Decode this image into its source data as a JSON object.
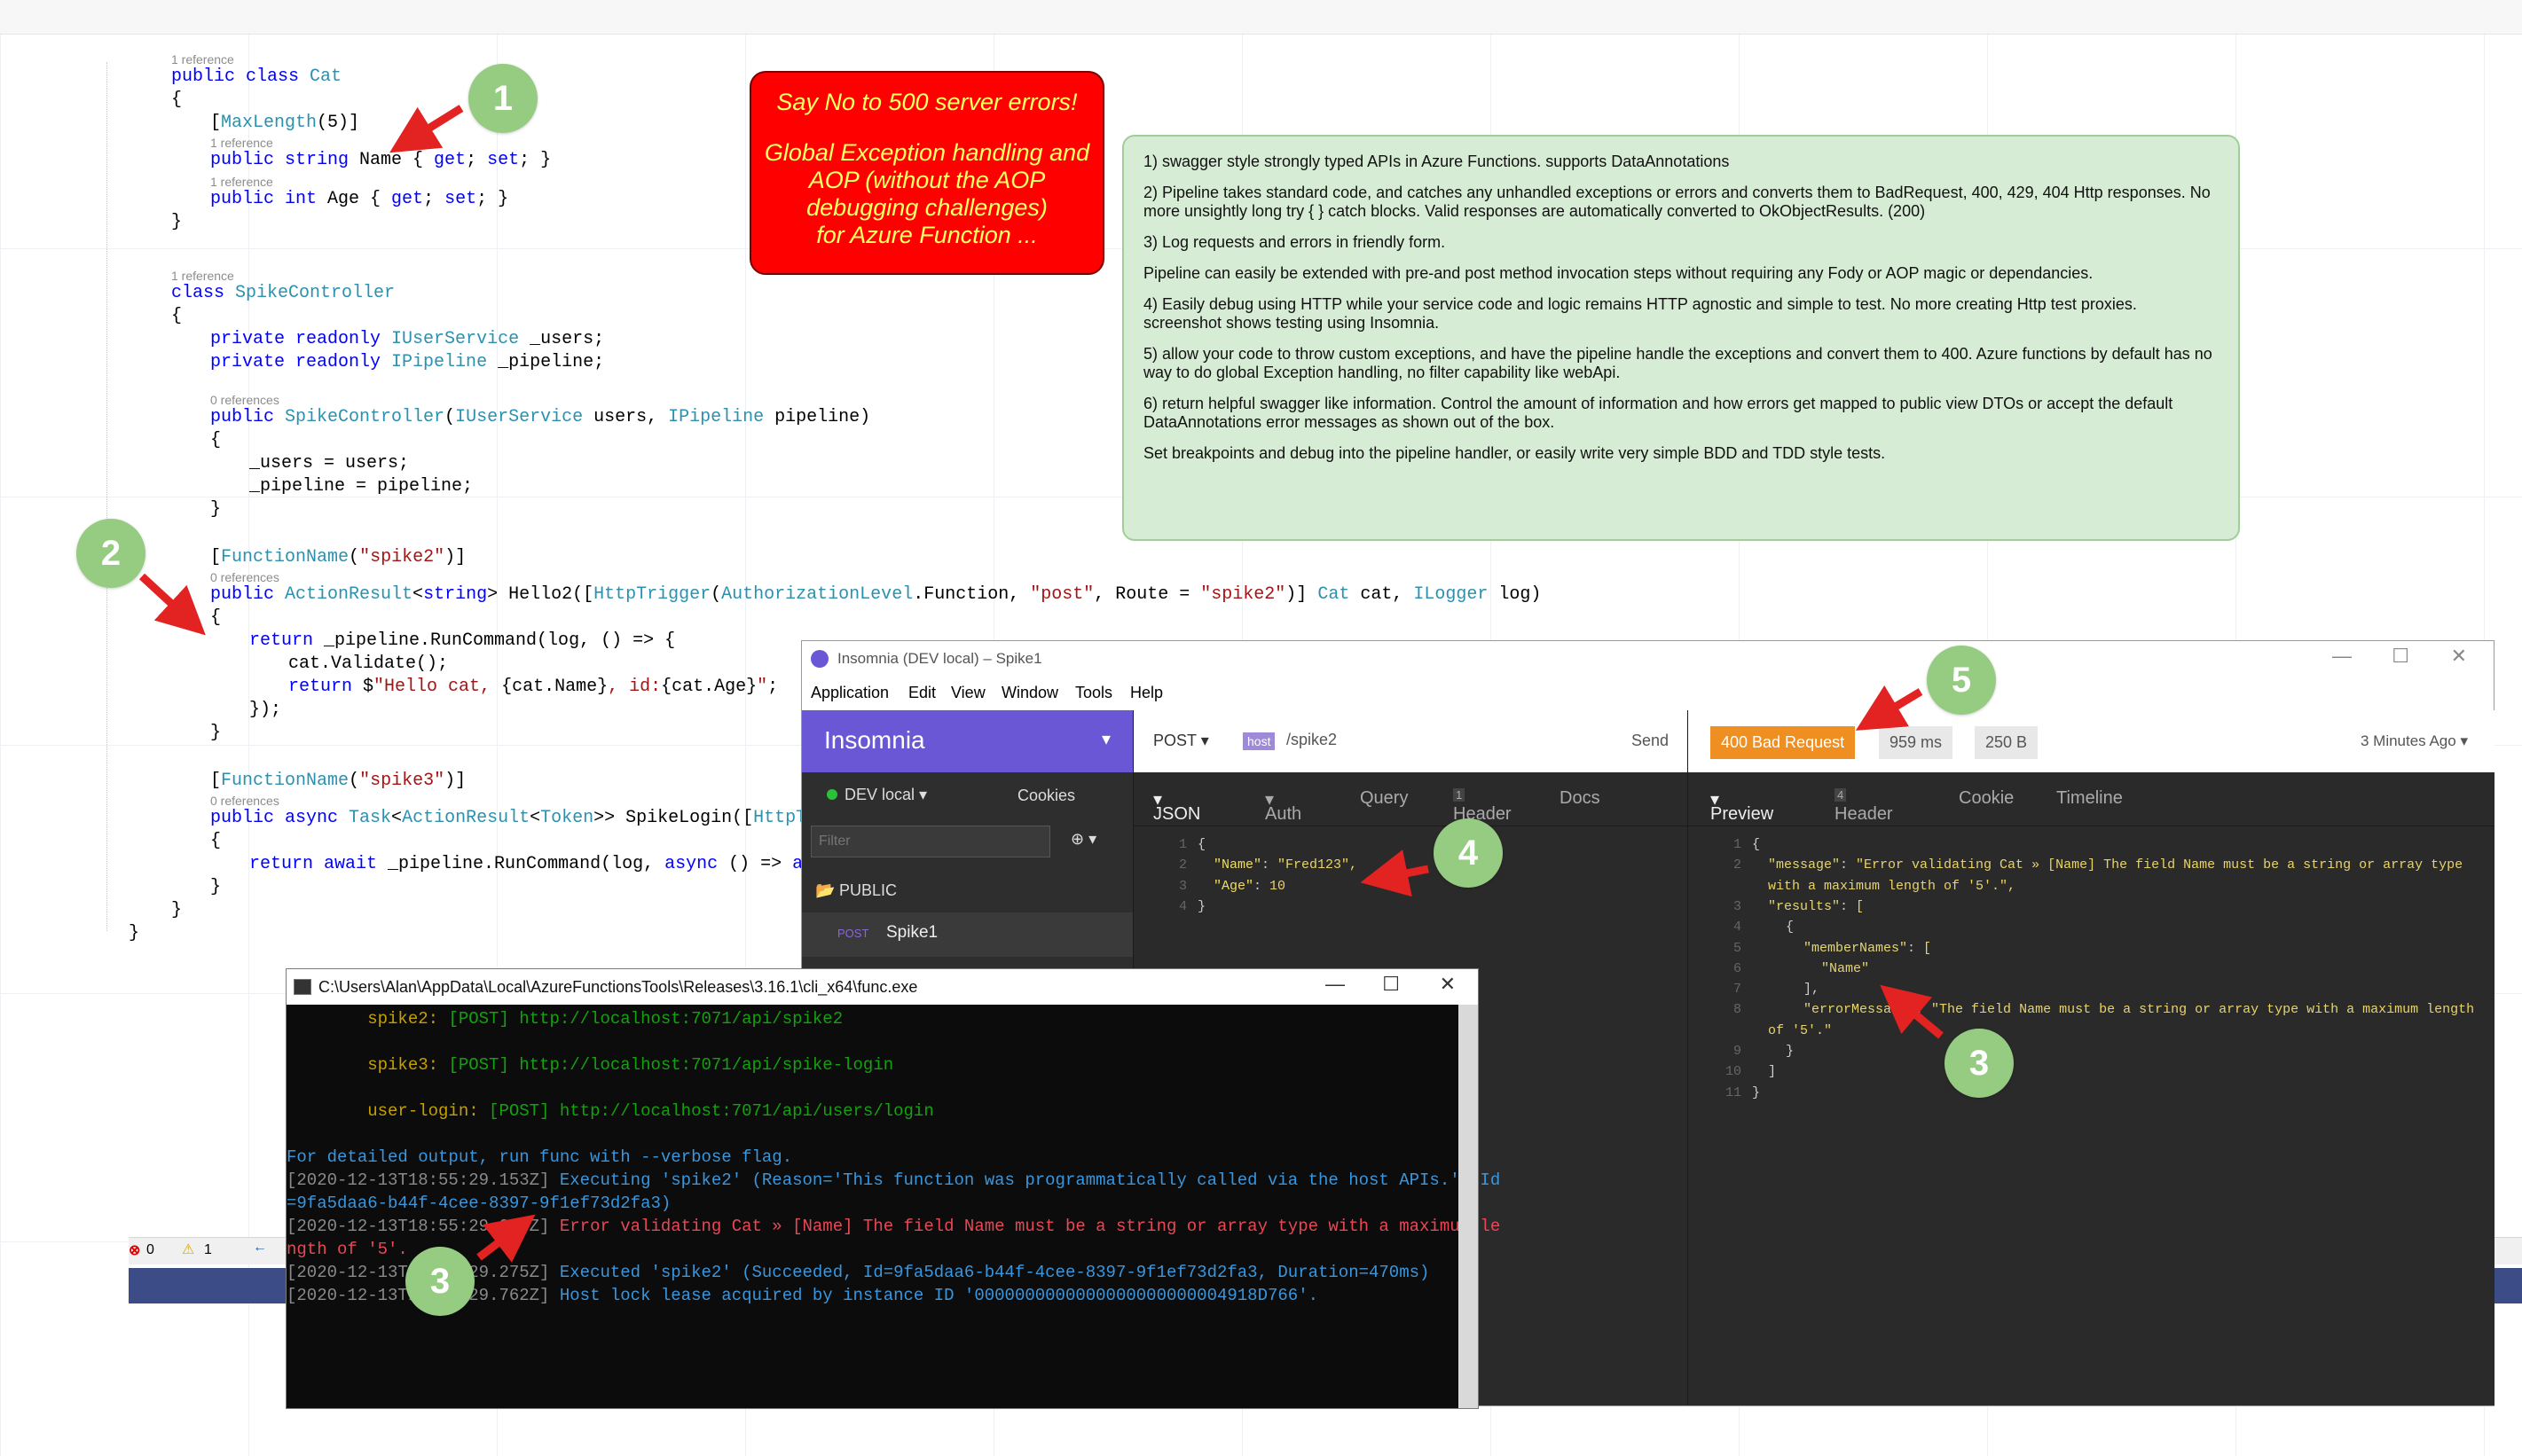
{
  "code": {
    "ref1": "1 reference",
    "ref0": "0 references",
    "l_class_cat": [
      "public class ",
      "Cat"
    ],
    "l_maxlength": [
      "[",
      "MaxLength",
      "(5)]"
    ],
    "l_name": [
      "public string ",
      "Name { ",
      "get",
      "; ",
      "set",
      "; }"
    ],
    "l_age": [
      "public int ",
      "Age { ",
      "get",
      "; ",
      "set",
      "; }"
    ],
    "l_class_spike": [
      "class ",
      "SpikeController"
    ],
    "l_users_field": [
      "private readonly ",
      "IUserService",
      " _users;"
    ],
    "l_pipeline_field": [
      "private readonly ",
      "IPipeline",
      " _pipeline;"
    ],
    "l_ctor": [
      "public ",
      "SpikeController",
      "(",
      "IUserService",
      " users, ",
      "IPipeline",
      " pipeline)"
    ],
    "l_assign_users": "_users = users;",
    "l_assign_pipeline": "_pipeline = pipeline;",
    "l_fn_spike2": [
      "[",
      "FunctionName",
      "(",
      "\"spike2\"",
      ")]"
    ],
    "l_hello2": [
      "public ",
      "ActionResult",
      "<",
      "string",
      "> Hello2([",
      "HttpTrigger",
      "(",
      "AuthorizationLevel",
      ".Function, ",
      "\"post\"",
      ", Route = ",
      "\"spike2\"",
      ")] ",
      "Cat",
      " cat, ",
      "ILogger",
      " log)"
    ],
    "l_return_pipeline": [
      "return",
      " _pipeline.RunCommand(log, () => {"
    ],
    "l_validate": "cat.Validate();",
    "l_return_hello": [
      "return",
      " $",
      "\"Hello cat, ",
      "{cat.Name}",
      ", id:",
      "{cat.Age}",
      "\"",
      ";"
    ],
    "l_close_lambda": "});",
    "l_fn_spike3": [
      "[",
      "FunctionName",
      "(",
      "\"spike3\"",
      ")]"
    ],
    "l_spikelogin": [
      "public async ",
      "Task",
      "<",
      "ActionResult",
      "<",
      "Token",
      ">> SpikeLogin([",
      "HttpTrigge"
    ],
    "l_return_await": [
      "return await",
      " _pipeline.RunCommand(log, ",
      "async",
      " () => ",
      "await"
    ],
    "brace_open": "{",
    "brace_close": "}"
  },
  "callout": {
    "title": "Say No to 500 server errors!",
    "lines": [
      "Global Exception handling and",
      "AOP (without the AOP",
      "debugging challenges)",
      "for Azure Function ..."
    ]
  },
  "notes": [
    "1) swagger style strongly typed APIs in Azure Functions. supports DataAnnotations",
    "2) Pipeline takes standard code, and catches any unhandled exceptions or errors and converts them to BadRequest, 400, 429, 404 Http responses. No more unsightly long try { } catch blocks. Valid responses are automatically converted to OkObjectResults. (200)",
    "3) Log requests and errors in friendly form.",
    "Pipeline can easily be extended with pre-and post method invocation steps without requiring any Fody or AOP magic or dependancies.",
    "4) Easily debug using HTTP while your service code and logic remains HTTP agnostic and simple to test. No more creating Http test proxies. screenshot shows testing using Insomnia.",
    "5) allow your code to throw custom exceptions, and have the pipeline handle the exceptions and convert them to 400. Azure functions by default has no way to do global Exception handling, no filter capability like webApi.",
    "6) return helpful swagger like information. Control the amount of information and how errors get mapped to public view DTOs or accept the default DataAnnotations error messages as shown out of the box.",
    "Set breakpoints and debug into the pipeline handler, or easily write very simple BDD and TDD style tests."
  ],
  "badges": [
    "1",
    "2",
    "3",
    "4",
    "5",
    "3",
    "3"
  ],
  "insomnia": {
    "window_title": "Insomnia (DEV local) – Spike1",
    "menu": [
      "Application",
      "Edit",
      "View",
      "Window",
      "Tools",
      "Help"
    ],
    "brand": "Insomnia",
    "env": "DEV local",
    "cookies": "Cookies",
    "filter_placeholder": "Filter",
    "folder": "PUBLIC",
    "req_method": "POST",
    "req_name": "Spike1",
    "method": "POST",
    "host_tag": "host",
    "url_path": "/spike2",
    "send": "Send",
    "req_tabs": {
      "json": "JSON",
      "auth": "Auth",
      "query": "Query",
      "header": "Header",
      "header_count": "1",
      "docs": "Docs"
    },
    "body_lines": [
      {
        "n": "1",
        "t": "{"
      },
      {
        "n": "2",
        "k": "\"Name\"",
        "v": "\"Fred123\","
      },
      {
        "n": "3",
        "k": "\"Age\"",
        "v": "10"
      },
      {
        "n": "4",
        "t": "}"
      }
    ],
    "status": "400 Bad Request",
    "time": "959 ms",
    "size": "250 B",
    "ago": "3 Minutes Ago",
    "resp_tabs": {
      "preview": "Preview",
      "header": "Header",
      "header_count": "4",
      "cookie": "Cookie",
      "timeline": "Timeline"
    },
    "resp_lines": [
      {
        "n": "1",
        "t": "{"
      },
      {
        "n": "2",
        "k": "\"message\"",
        "v": "\"Error validating Cat » [Name] The field Name must be a string or array type"
      },
      {
        "n": "",
        "v": "with a maximum length of '5'.\","
      },
      {
        "n": "3",
        "k": "\"results\"",
        "v": "["
      },
      {
        "n": "4",
        "t": "{"
      },
      {
        "n": "5",
        "k": "\"memberNames\"",
        "v": "["
      },
      {
        "n": "6",
        "v": "\"Name\""
      },
      {
        "n": "7",
        "t": "],"
      },
      {
        "n": "8",
        "k": "\"errorMessage\"",
        "v": "\"The field Name must be a string or array type with a maximum length"
      },
      {
        "n": "",
        "v": "of '5'.\""
      },
      {
        "n": "9",
        "t": "}"
      },
      {
        "n": "10",
        "t": "]"
      },
      {
        "n": "11",
        "t": "}"
      }
    ]
  },
  "terminal": {
    "title": "C:\\Users\\Alan\\AppData\\Local\\AzureFunctionsTools\\Releases\\3.16.1\\cli_x64\\func.exe",
    "lines": [
      {
        "a": "        spike2: ",
        "b": "[POST] http://localhost:7071/api/spike2"
      },
      {
        "a": "        spike3: ",
        "b": "[POST] http://localhost:7071/api/spike-login"
      },
      {
        "a": "        user-login: ",
        "b": "[POST] http://localhost:7071/api/users/login"
      },
      {
        "c": "For detailed output, run func with --verbose flag."
      },
      {
        "ts": "[2020-12-13T18:55:29.153Z] ",
        "c": "Executing 'spike2' (Reason='This function was programmatically called via the host APIs.', Id"
      },
      {
        "c": "=9fa5daa6-b44f-4cee-8397-9f1ef73d2fa3)"
      },
      {
        "ts": "[2020-12-13T18:55:29.243Z] ",
        "r": "Error validating Cat » [Name] The field Name must be a string or array type with a maximum le"
      },
      {
        "r": "ngth of '5'."
      },
      {
        "ts": "[2020-12-13T18:55:29.275Z] ",
        "c": "Executed 'spike2' (Succeeded, Id=9fa5daa6-b44f-4cee-8397-9f1ef73d2fa3, Duration=470ms)"
      },
      {
        "ts": "[2020-12-13T18:55:29.762Z] ",
        "c": "Host lock lease acquired by instance ID '0000000000000000000000004918D766'."
      }
    ]
  },
  "vs_status": {
    "errors": "0",
    "warnings": "1"
  },
  "colors": {
    "insomnia_purple": "#6a57d5",
    "status_orange": "#ef8f22",
    "badge_green": "#96cc82",
    "callout_red": "#ff0000"
  }
}
